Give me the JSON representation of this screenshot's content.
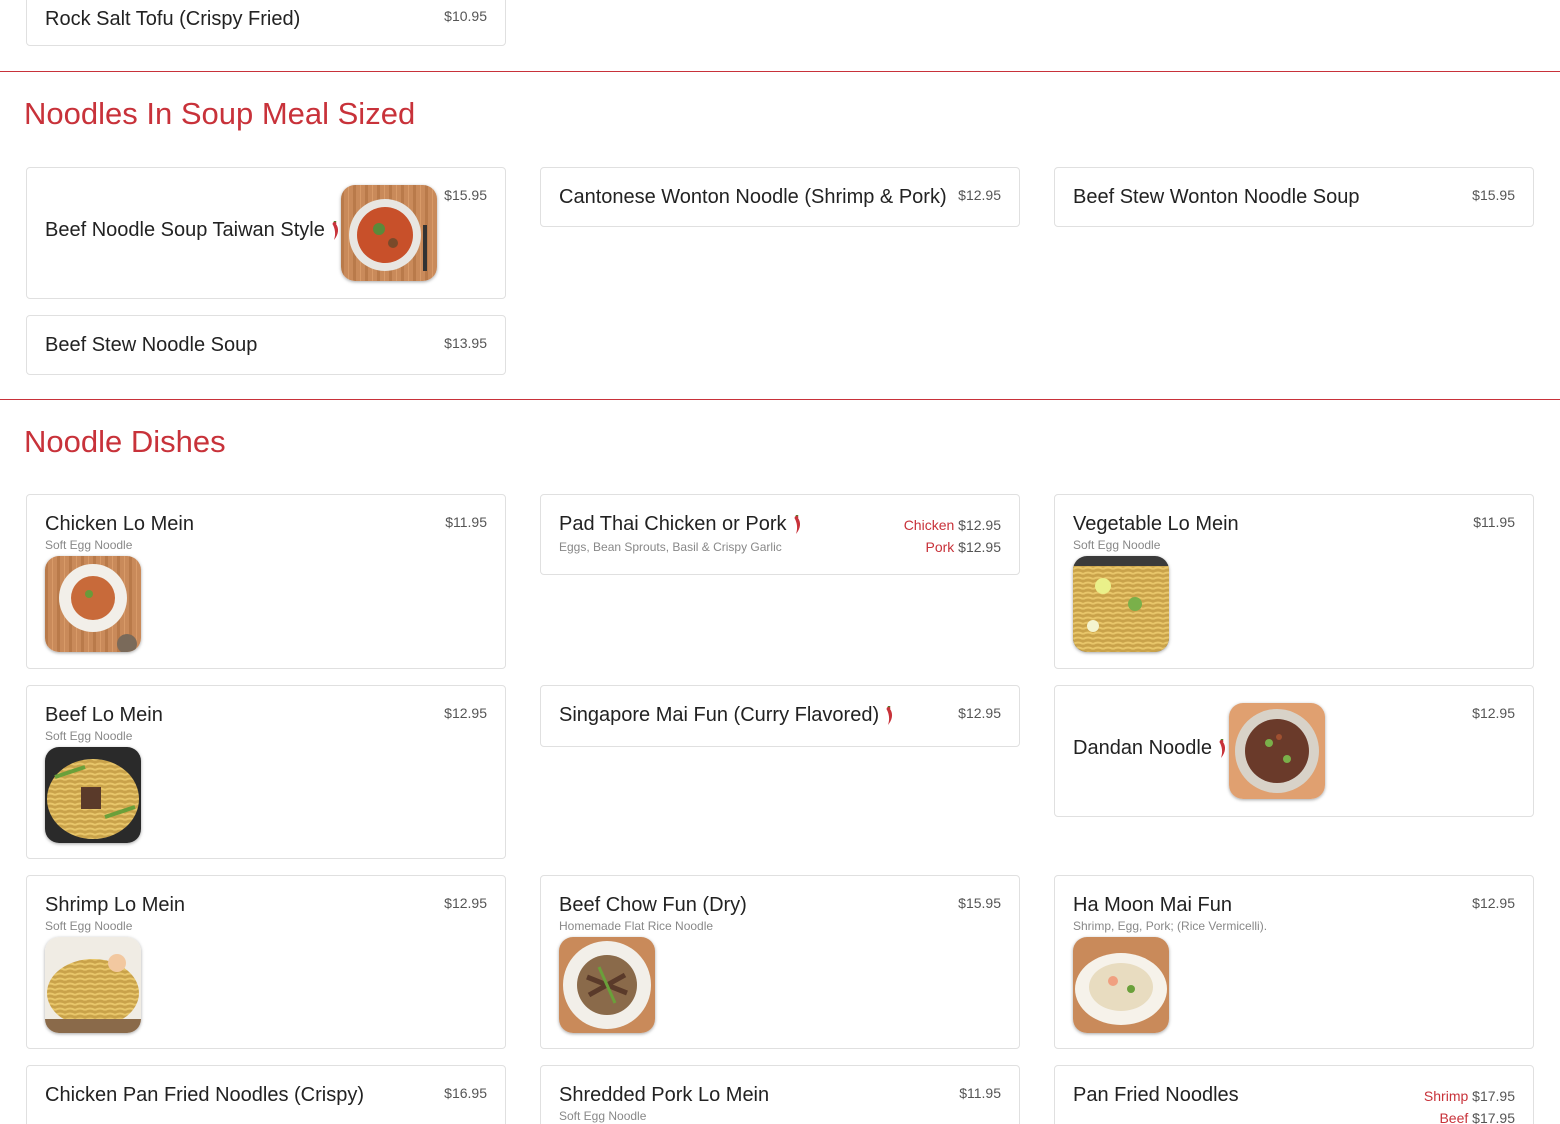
{
  "colors": {
    "accent": "#c8323a",
    "card_border": "#e0e0e0",
    "desc": "#888888"
  },
  "top_item": {
    "name": "Rock Salt Tofu (Crispy Fried)",
    "price": "$10.95"
  },
  "sections": [
    {
      "title": "Noodles In Soup Meal Sized",
      "items": [
        {
          "name": "Beef Noodle Soup Taiwan Style",
          "price": "$15.95",
          "spicy": true,
          "image": "soup-bowl-image"
        },
        {
          "name": "Cantonese Wonton Noodle (Shrimp & Pork)",
          "price": "$12.95"
        },
        {
          "name": "Beef Stew Wonton Noodle Soup",
          "price": "$15.95"
        },
        {
          "name": "Beef Stew Noodle Soup",
          "price": "$13.95"
        }
      ]
    },
    {
      "title": "Noodle Dishes",
      "items": [
        {
          "name": "Chicken Lo Mein",
          "desc": "Soft Egg Noodle",
          "price": "$11.95",
          "image": "lo-mein-plate-image"
        },
        {
          "name": "Pad Thai Chicken or Pork",
          "desc": "Eggs, Bean Sprouts, Basil & Crispy Garlic",
          "spicy": true,
          "options": [
            {
              "label": "Chicken",
              "price": "$12.95"
            },
            {
              "label": "Pork",
              "price": "$12.95"
            }
          ]
        },
        {
          "name": "Vegetable Lo Mein",
          "desc": "Soft Egg Noodle",
          "price": "$11.95",
          "image": "vegetable-noodle-image"
        },
        {
          "name": "Beef Lo Mein",
          "desc": "Soft Egg Noodle",
          "price": "$12.95",
          "image": "beef-noodle-image"
        },
        {
          "name": "Singapore Mai Fun (Curry Flavored)",
          "price": "$12.95",
          "spicy": true
        },
        {
          "name": "Dandan Noodle",
          "price": "$12.95",
          "spicy": true,
          "image": "dandan-bowl-image"
        },
        {
          "name": "Shrimp Lo Mein",
          "desc": "Soft Egg Noodle",
          "price": "$12.95",
          "image": "shrimp-noodle-image"
        },
        {
          "name": "Beef Chow Fun (Dry)",
          "desc": "Homemade Flat Rice Noodle",
          "price": "$15.95",
          "image": "chow-fun-plate-image"
        },
        {
          "name": "Ha Moon Mai Fun",
          "desc": "Shrimp, Egg, Pork; (Rice Vermicelli).",
          "price": "$12.95",
          "image": "mai-fun-plate-image"
        },
        {
          "name": "Chicken Pan Fried Noodles (Crispy)",
          "price": "$16.95"
        },
        {
          "name": "Shredded Pork Lo Mein",
          "desc": "Soft Egg Noodle",
          "price": "$11.95"
        },
        {
          "name": "Pan Fried Noodles",
          "options": [
            {
              "label": "Shrimp",
              "price": "$17.95"
            },
            {
              "label": "Beef",
              "price": "$17.95"
            }
          ]
        }
      ]
    }
  ]
}
